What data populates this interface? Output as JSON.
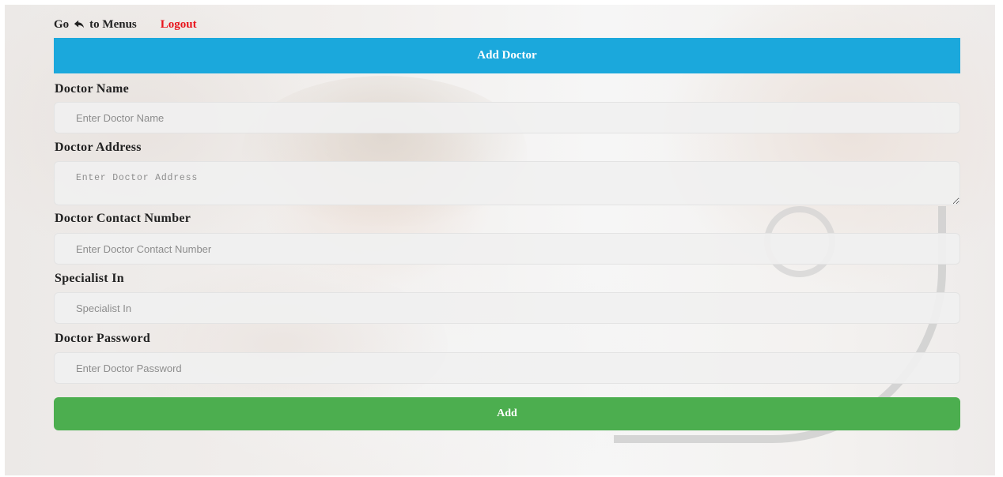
{
  "nav": {
    "go_label": "Go",
    "menus_label": "to Menus",
    "back_icon": "undo-arrow-icon",
    "logout_label": "Logout",
    "logout_color": "#e8141c"
  },
  "header": {
    "title": "Add Doctor",
    "color": "#1ba8dc"
  },
  "form": {
    "doctor_name": {
      "label": "Doctor Name",
      "placeholder": "Enter Doctor Name",
      "value": ""
    },
    "doctor_address": {
      "label": "Doctor Address",
      "placeholder": "Enter Doctor Address",
      "value": ""
    },
    "doctor_contact": {
      "label": "Doctor Contact Number",
      "placeholder": "Enter Doctor Contact Number",
      "value": ""
    },
    "specialist": {
      "label": "Specialist In",
      "placeholder": "Specialist In",
      "value": ""
    },
    "doctor_password": {
      "label": "Doctor Password",
      "placeholder": "Enter Doctor Password",
      "value": ""
    },
    "submit_label": "Add",
    "submit_color": "#4cae4f"
  }
}
